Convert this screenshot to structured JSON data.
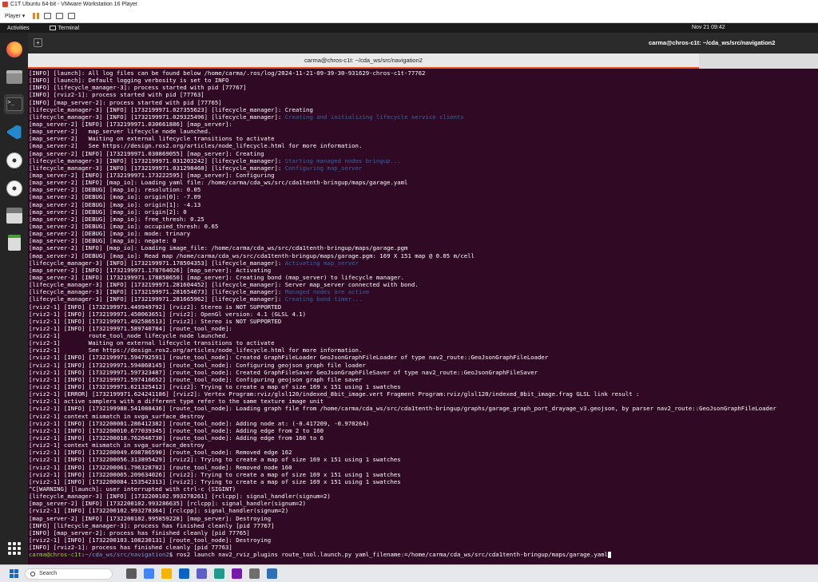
{
  "vm": {
    "title": "C1T Ubuntu 64-bit - VMware Workstation 16 Player",
    "player_menu": "Player ▾"
  },
  "gnome": {
    "activities": "Activities",
    "app_name": "Terminal",
    "clock": "Nov 21  09:42"
  },
  "dock": [
    "firefox-icon",
    "files-icon",
    "terminal-icon",
    "vscode-icon",
    "disc-icon",
    "disc-icon",
    "floppy-icon",
    "trash-icon",
    "show-apps-icon"
  ],
  "terminal": {
    "header_title": "carma@chros-c1t: ~/cda_ws/src/navigation2",
    "tab_title": "carma@chros-c1t: ~/cda_ws/src/navigation2",
    "lines": [
      {
        "t": "[INFO] [launch]: All log files can be found below /home/carma/.ros/log/2024-11-21-09-39-30-931629-chros-c1t-77762"
      },
      {
        "t": "[INFO] [launch]: Default logging verbosity is set to INFO"
      },
      {
        "t": "[INFO] [lifecycle_manager-3]: process started with pid [77767]"
      },
      {
        "t": "[INFO] [rviz2-1]: process started with pid [77763]"
      },
      {
        "t": "[INFO] [map_server-2]: process started with pid [77765]"
      },
      {
        "t": "[lifecycle_manager-3] [INFO] [1732199971.027355623] [lifecycle_manager]: Creating"
      },
      {
        "t": "[lifecycle_manager-3] [INFO] [1732199971.029325496] [lifecycle_manager]: ",
        "h": "Creating and initializing lifecycle service clients"
      },
      {
        "t": "[map_server-2] [INFO] [1732199971.030661886] [map_server]:"
      },
      {
        "t": "[map_server-2]   map_server lifecycle node launched."
      },
      {
        "t": "[map_server-2]   Waiting on external lifecycle transitions to activate"
      },
      {
        "t": "[map_server-2]   See https://design.ros2.org/articles/node_lifecycle.html for more information."
      },
      {
        "t": "[map_server-2] [INFO] [1732199971.030869055] [map_server]: Creating"
      },
      {
        "t": "[lifecycle_manager-3] [INFO] [1732199971.031203242] [lifecycle_manager]: ",
        "h": "Starting managed nodes bringup..."
      },
      {
        "t": "[lifecycle_manager-3] [INFO] [1732199971.031298460] [lifecycle_manager]: ",
        "h": "Configuring map_server"
      },
      {
        "t": "[map_server-2] [INFO] [1732199971.173222595] [map_server]: Configuring"
      },
      {
        "t": "[map_server-2] [INFO] [map_io]: Loading yaml file: /home/carma/cda_ws/src/cda1tenth-bringup/maps/garage.yaml"
      },
      {
        "t": "[map_server-2] [DEBUG] [map_io]: resolution: 0.05"
      },
      {
        "t": "[map_server-2] [DEBUG] [map_io]: origin[0]: -7.09"
      },
      {
        "t": "[map_server-2] [DEBUG] [map_io]: origin[1]: -4.13"
      },
      {
        "t": "[map_server-2] [DEBUG] [map_io]: origin[2]: 0"
      },
      {
        "t": "[map_server-2] [DEBUG] [map_io]: free_thresh: 0.25"
      },
      {
        "t": "[map_server-2] [DEBUG] [map_io]: occupied_thresh: 0.65"
      },
      {
        "t": "[map_server-2] [DEBUG] [map_io]: mode: trinary"
      },
      {
        "t": "[map_server-2] [DEBUG] [map_io]: negate: 0"
      },
      {
        "t": "[map_server-2] [INFO] [map_io]: Loading image_file: /home/carma/cda_ws/src/cda1tenth-bringup/maps/garage.pgm"
      },
      {
        "t": "[map_server-2] [DEBUG] [map_io]: Read map /home/carma/cda_ws/src/cda1tenth-bringup/maps/garage.pgm: 169 X 151 map @ 0.05 m/cell"
      },
      {
        "t": "[lifecycle_manager-3] [INFO] [1732199971.178504353] [lifecycle_manager]: ",
        "h": "Activating map_server"
      },
      {
        "t": "[map_server-2] [INFO] [1732199971.178764026] [map_server]: Activating"
      },
      {
        "t": "[map_server-2] [INFO] [1732199971.178858650] [map_server]: Creating bond (map_server) to lifecycle manager."
      },
      {
        "t": "[lifecycle_manager-3] [INFO] [1732199971.281604452] [lifecycle_manager]: Server map_server connected with bond."
      },
      {
        "t": "[lifecycle_manager-3] [INFO] [1732199971.281654673] [lifecycle_manager]: ",
        "h": "Managed nodes are active"
      },
      {
        "t": "[lifecycle_manager-3] [INFO] [1732199971.281665962] [lifecycle_manager]: ",
        "h": "Creating bond timer..."
      },
      {
        "t": "[rviz2-1] [INFO] [1732199971.449949792] [rviz2]: Stereo is NOT SUPPORTED"
      },
      {
        "t": "[rviz2-1] [INFO] [1732199971.450063651] [rviz2]: OpenGl version: 4.1 (GLSL 4.1)"
      },
      {
        "t": "[rviz2-1] [INFO] [1732199971.492586513] [rviz2]: Stereo is NOT SUPPORTED"
      },
      {
        "t": "[rviz2-1] [INFO] [1732199971.589740784] [route_tool_node]:"
      },
      {
        "t": "[rviz2-1]        route_tool_node lifecycle node launched."
      },
      {
        "t": "[rviz2-1]        Waiting on external lifecycle transitions to activate"
      },
      {
        "t": "[rviz2-1]        See https://design.ros2.org/articles/node_lifecycle.html for more information."
      },
      {
        "t": "[rviz2-1] [INFO] [1732199971.594792591] [route_tool_node]: Created GraphFileLoader GeoJsonGraphFileLoader of type nav2_route::GeoJsonGraphFileLoader"
      },
      {
        "t": "[rviz2-1] [INFO] [1732199971.594868145] [route_tool_node]: Configuring geojson graph file loader"
      },
      {
        "t": "[rviz2-1] [INFO] [1732199971.597323487] [route_tool_node]: Created GraphFileSaver GeoJsonGraphFileSaver of type nav2_route::GeoJsonGraphFileSaver"
      },
      {
        "t": "[rviz2-1] [INFO] [1732199971.597416652] [route_tool_node]: Configuring geojson graph file saver"
      },
      {
        "t": "[rviz2-1] [INFO] [1732199971.621325412] [rviz2]: Trying to create a map of size 169 x 151 using 1 swatches"
      },
      {
        "t": "[rviz2-1] [ERROR] [1732199971.624241186] [rviz2]: Vertex Program:rviz/glsl120/indexed_8bit_image.vert Fragment Program:rviz/glsl120/indexed_8bit_image.frag GLSL link result :"
      },
      {
        "t": "[rviz2-1] active samplers with a different type refer to the same texture image unit"
      },
      {
        "t": "[rviz2-1] [INFO] [1732199988.541088436] [route_tool_node]: Loading graph file from /home/carma/cda_ws/src/cda1tenth-bringup/graphs/garage_graph_port_drayage_v3.geojson, by parser nav2_route::GeoJsonGraphFileLoader"
      },
      {
        "t": "[rviz2-1] context mismatch in svga_surface_destroy"
      },
      {
        "t": "[rviz2-1] [INFO] [1732200001.286412382] [route_tool_node]: Adding node at: (-0.417209, -0.970264)"
      },
      {
        "t": "[rviz2-1] [INFO] [1732200010.677039345] [route_tool_node]: Adding edge from 2 to 160"
      },
      {
        "t": "[rviz2-1] [INFO] [1732200018.762046730] [route_tool_node]: Adding edge from 160 to 6"
      },
      {
        "t": "[rviz2-1] context mismatch in svga_surface_destroy"
      },
      {
        "t": "[rviz2-1] [INFO] [1732200049.698786590] [route_tool_node]: Removed edge 162"
      },
      {
        "t": "[rviz2-1] [INFO] [1732200056.313895429] [rviz2]: Trying to create a map of size 169 x 151 using 1 swatches"
      },
      {
        "t": "[rviz2-1] [INFO] [1732200061.796328702] [route_tool_node]: Removed node 160"
      },
      {
        "t": "[rviz2-1] [INFO] [1732200065.209634026] [rviz2]: Trying to create a map of size 169 x 151 using 1 swatches"
      },
      {
        "t": "[rviz2-1] [INFO] [1732200084.153542313] [rviz2]: Trying to create a map of size 169 x 151 using 1 swatches"
      },
      {
        "t": "^C[WARNING] [launch]: user interrupted with ctrl-c (SIGINT)"
      },
      {
        "t": "[lifecycle_manager-3] [INFO] [1732200102.993278261] [rclcpp]: signal_handler(signum=2)"
      },
      {
        "t": "[map_server-2] [INFO] [1732200102.993286635] [rclcpp]: signal_handler(signum=2)"
      },
      {
        "t": "[rviz2-1] [INFO] [1732200102.993278364] [rclcpp]: signal_handler(signum=2)"
      },
      {
        "t": "[map_server-2] [INFO] [1732200102.995859228] [map_server]: Destroying"
      },
      {
        "t": "[INFO] [lifecycle_manager-3]: process has finished cleanly [pid 77767]"
      },
      {
        "t": "[INFO] [map_server-2]: process has finished cleanly [pid 77765]"
      },
      {
        "t": "[rviz2-1] [INFO] [1732200103.108230131] [route_tool_node]: Destroying"
      },
      {
        "t": "[INFO] [rviz2-1]: process has finished cleanly [pid 77763]"
      }
    ],
    "prompt": {
      "user": "carma@chros-c1t",
      "path": "~/cda_ws/src/navigation2",
      "command": "$ ros2 launch nav2_rviz_plugins route_tool.launch.py yaml_filename:=/home/carma/cda_ws/src/cda1tenth-bringup/maps/garage.yaml"
    }
  },
  "taskbar": {
    "search_placeholder": "Search",
    "icons": [
      "file-explorer-icon",
      "chrome-icon",
      "folder-icon",
      "outlook-icon",
      "teams-icon",
      "edge-icon",
      "onenote-icon",
      "vmware-icon",
      "remote-desktop-icon"
    ],
    "colors": [
      "#5a5a5a",
      "#4285f4",
      "#f4b400",
      "#0a64c4",
      "#5b5fc7",
      "#1e9b8a",
      "#7719aa",
      "#6e6e6e",
      "#2f6fb3"
    ]
  }
}
